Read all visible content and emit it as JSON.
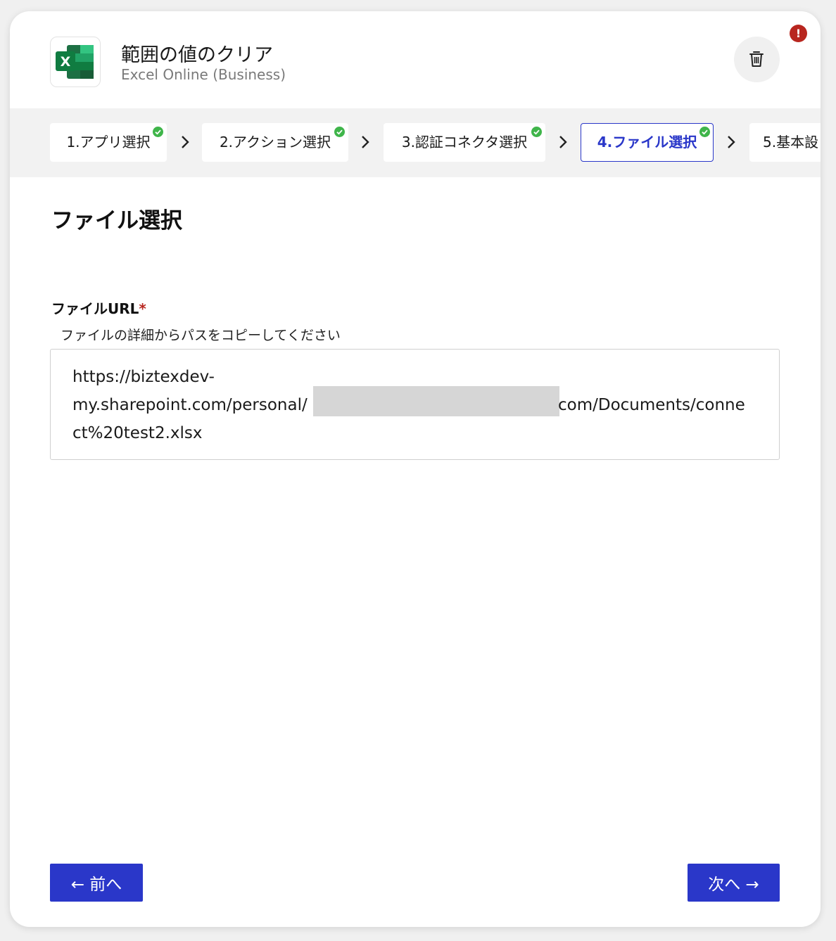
{
  "header": {
    "title": "範囲の値のクリア",
    "subtitle": "Excel Online (Business)",
    "logo_letter": "X",
    "error_badge": "!"
  },
  "steps": [
    {
      "label": "1.アプリ選択",
      "completed": true,
      "active": false
    },
    {
      "label": "2.アクション選択",
      "completed": true,
      "active": false
    },
    {
      "label": "3.認証コネクタ選択",
      "completed": true,
      "active": false
    },
    {
      "label": "4.ファイル選択",
      "completed": true,
      "active": true
    },
    {
      "label": "5.基本設",
      "completed": false,
      "active": false
    }
  ],
  "section": {
    "title": "ファイル選択"
  },
  "field": {
    "label": "ファイルURL",
    "required_mark": "*",
    "help": "ファイルの詳細からパスをコピーしてください",
    "value_lines": [
      "https://biztexdev-",
      "my.sharepoint.com/personal/",
      "com/Documents/conne",
      "ct%20test2.xlsx"
    ]
  },
  "buttons": {
    "prev": "← 前へ",
    "next": "次へ →"
  },
  "colors": {
    "accent": "#2a37c9",
    "error": "#b8261f",
    "check": "#3fb54a",
    "excel_green": "#1d7044"
  },
  "icons": {
    "app": "excel-icon",
    "delete": "trash-icon",
    "error": "error-badge-icon",
    "step_done": "check-circle-icon",
    "separator": "chevron-right-icon"
  }
}
